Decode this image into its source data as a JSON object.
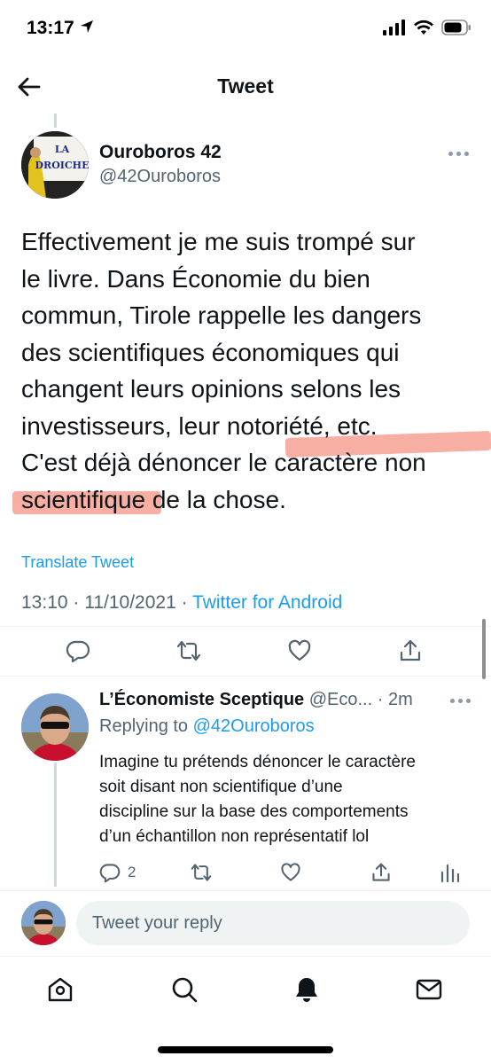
{
  "status_bar": {
    "time": "13:17"
  },
  "header": {
    "title": "Tweet"
  },
  "tweet": {
    "author_name": "Ouroboros 42",
    "author_handle": "@42Ouroboros",
    "avatar_caption_line1": "LA",
    "avatar_caption_line2": "DROICHE",
    "lines": [
      "Effectivement je me suis trompé sur",
      "le livre. Dans Économie du bien",
      "commun, Tirole rappelle les dangers",
      "des scientifiques économiques qui",
      "changent leurs opinions selons les",
      "investisseurs, leur notoriété, etc.",
      "C'est déjà dénoncer le caractère non",
      "scientifique de la chose."
    ],
    "translate_label": "Translate Tweet",
    "timestamp": "13:10 · 11/10/2021 · ",
    "source": "Twitter for Android",
    "highlight_color": "#f06e5a"
  },
  "reply": {
    "name": "L’Économiste Sceptique",
    "handle": "@Eco...",
    "time": "· 2m",
    "replying_prefix": "Replying to ",
    "replying_mention": "@42Ouroboros",
    "text_lines": [
      "Imagine tu prétends dénoncer le caractère",
      "soit disant non scientifique d’une",
      "discipline sur la base des comportements",
      "d’un échantillon non représentatif lol"
    ],
    "reply_count": "2"
  },
  "composer": {
    "placeholder": "Tweet your reply"
  },
  "colors": {
    "accent": "#1d9bf0",
    "secondary_text": "#536471"
  },
  "icons": {
    "tweet_actions": [
      "reply-icon",
      "retweet-icon",
      "like-icon",
      "share-icon"
    ],
    "reply_actions": [
      "reply-icon",
      "retweet-icon",
      "like-icon",
      "share-icon",
      "analytics-icon"
    ],
    "tabs": [
      "home-icon",
      "search-icon",
      "notifications-icon",
      "messages-icon"
    ]
  }
}
